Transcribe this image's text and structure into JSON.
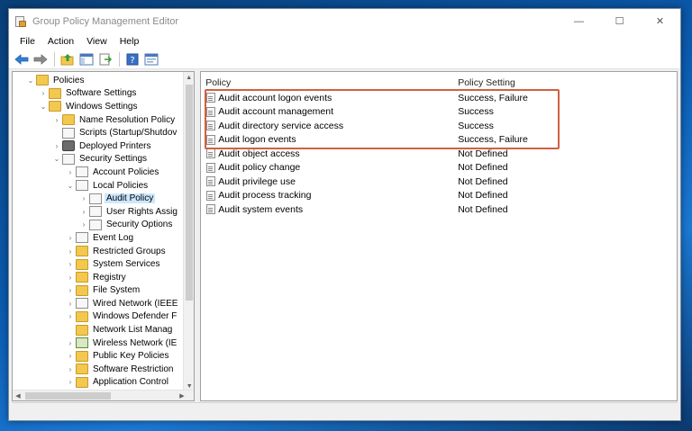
{
  "window": {
    "title": "Group Policy Management Editor",
    "controls": {
      "minimize": "—",
      "maximize": "☐",
      "close": "✕"
    }
  },
  "menu": [
    "File",
    "Action",
    "View",
    "Help"
  ],
  "toolbar": [
    "back-icon",
    "forward-icon",
    "up-folder-icon",
    "show-tree-icon",
    "export-list-icon",
    "help-icon",
    "properties-icon"
  ],
  "tree": [
    {
      "label": "Policies",
      "level": 1,
      "expander": "⌄",
      "icon": "folder"
    },
    {
      "label": "Software Settings",
      "level": 2,
      "expander": "›",
      "icon": "folder"
    },
    {
      "label": "Windows Settings",
      "level": 2,
      "expander": "⌄",
      "icon": "folder"
    },
    {
      "label": "Name Resolution Policy",
      "level": 3,
      "expander": "›",
      "icon": "folder"
    },
    {
      "label": "Scripts (Startup/Shutdov",
      "level": 3,
      "expander": "",
      "icon": "doc"
    },
    {
      "label": "Deployed Printers",
      "level": 3,
      "expander": "›",
      "icon": "printer"
    },
    {
      "label": "Security Settings",
      "level": 3,
      "expander": "⌄",
      "icon": "doc"
    },
    {
      "label": "Account Policies",
      "level": 4,
      "expander": "›",
      "icon": "doc"
    },
    {
      "label": "Local Policies",
      "level": 4,
      "expander": "⌄",
      "icon": "doc"
    },
    {
      "label": "Audit Policy",
      "level": 5,
      "expander": "›",
      "icon": "doc",
      "selected": true
    },
    {
      "label": "User Rights Assig",
      "level": 5,
      "expander": "›",
      "icon": "doc"
    },
    {
      "label": "Security Options",
      "level": 5,
      "expander": "›",
      "icon": "doc"
    },
    {
      "label": "Event Log",
      "level": 4,
      "expander": "›",
      "icon": "doc"
    },
    {
      "label": "Restricted Groups",
      "level": 4,
      "expander": "›",
      "icon": "folder"
    },
    {
      "label": "System Services",
      "level": 4,
      "expander": "›",
      "icon": "folder"
    },
    {
      "label": "Registry",
      "level": 4,
      "expander": "›",
      "icon": "folder"
    },
    {
      "label": "File System",
      "level": 4,
      "expander": "›",
      "icon": "folder"
    },
    {
      "label": "Wired Network (IEEE",
      "level": 4,
      "expander": "›",
      "icon": "doc"
    },
    {
      "label": "Windows Defender F",
      "level": 4,
      "expander": "›",
      "icon": "folder"
    },
    {
      "label": "Network List Manag",
      "level": 4,
      "expander": "",
      "icon": "folder"
    },
    {
      "label": "Wireless Network (IE",
      "level": 4,
      "expander": "›",
      "icon": "wifi"
    },
    {
      "label": "Public Key Policies",
      "level": 4,
      "expander": "›",
      "icon": "folder"
    },
    {
      "label": "Software Restriction",
      "level": 4,
      "expander": "›",
      "icon": "folder"
    },
    {
      "label": "Application Control",
      "level": 4,
      "expander": "›",
      "icon": "folder"
    }
  ],
  "list": {
    "columns": {
      "policy": "Policy",
      "setting": "Policy Setting"
    },
    "rows": [
      {
        "policy": "Audit account logon events",
        "setting": "Success, Failure"
      },
      {
        "policy": "Audit account management",
        "setting": "Success"
      },
      {
        "policy": "Audit directory service access",
        "setting": "Success"
      },
      {
        "policy": "Audit logon events",
        "setting": "Success, Failure"
      },
      {
        "policy": "Audit object access",
        "setting": "Not Defined"
      },
      {
        "policy": "Audit policy change",
        "setting": "Not Defined"
      },
      {
        "policy": "Audit privilege use",
        "setting": "Not Defined"
      },
      {
        "policy": "Audit process tracking",
        "setting": "Not Defined"
      },
      {
        "policy": "Audit system events",
        "setting": "Not Defined"
      }
    ]
  },
  "colors": {
    "selection": "#cce8ff",
    "highlight_box": "#d25f41"
  }
}
